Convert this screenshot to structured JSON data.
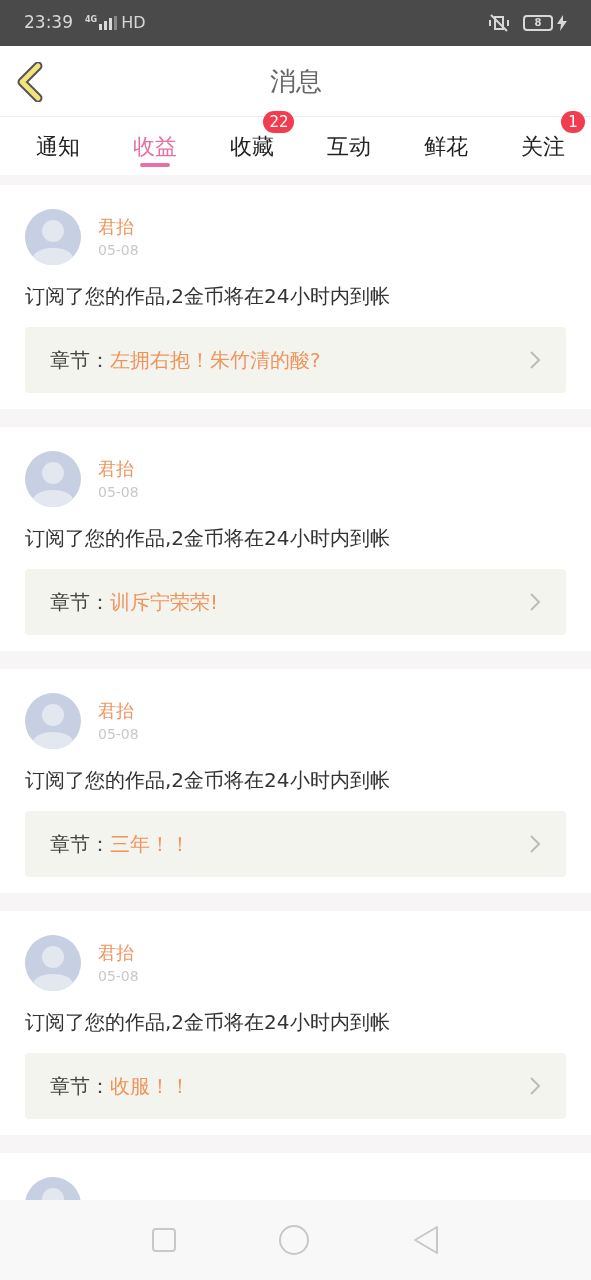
{
  "status_bar": {
    "time": "23:39",
    "network": "4G",
    "hd": "HD",
    "battery": "8"
  },
  "header": {
    "title": "消息"
  },
  "tabs": [
    {
      "label": "通知",
      "selected": false
    },
    {
      "label": "收益",
      "selected": true
    },
    {
      "label": "收藏",
      "selected": false,
      "badge": "22"
    },
    {
      "label": "互动",
      "selected": false
    },
    {
      "label": "鲜花",
      "selected": false
    },
    {
      "label": "关注",
      "selected": false,
      "badge": "1"
    }
  ],
  "messages": [
    {
      "kind": "full",
      "user": "君抬",
      "date": "05-08",
      "text": "订阅了您的作品,2金币将在24小时内到帐",
      "chapter_label": "章节：",
      "chapter": "左拥右抱！朱竹清的酸?"
    },
    {
      "kind": "full",
      "user": "君抬",
      "date": "05-08",
      "text": "订阅了您的作品,2金币将在24小时内到帐",
      "chapter_label": "章节：",
      "chapter": "训斥宁荣荣!"
    },
    {
      "kind": "full",
      "user": "君抬",
      "date": "05-08",
      "text": "订阅了您的作品,2金币将在24小时内到帐",
      "chapter_label": "章节：",
      "chapter": "三年！！"
    },
    {
      "kind": "full",
      "user": "君抬",
      "date": "05-08",
      "text": "订阅了您的作品,2金币将在24小时内到帐",
      "chapter_label": "章节：",
      "chapter": "收服！！"
    },
    {
      "kind": "cut_off"
    }
  ]
}
